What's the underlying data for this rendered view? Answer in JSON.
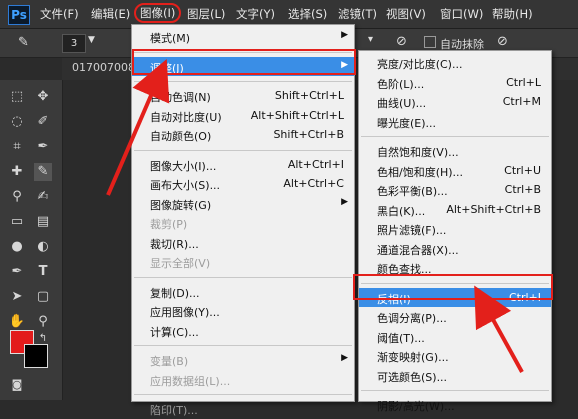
{
  "app": {
    "logo": "Ps"
  },
  "menubar": {
    "items": [
      "文件(F)",
      "编辑(E)",
      "图像(I)",
      "图层(L)",
      "文字(Y)",
      "选择(S)",
      "滤镜(T)",
      "视图(V)",
      "窗口(W)",
      "帮助(H)"
    ]
  },
  "options": {
    "brush_size": "3",
    "auto_erase": "自动抹除"
  },
  "document": {
    "tab": "017007008"
  },
  "image_menu": [
    {
      "label": "模式(M)",
      "shortcut": "",
      "submenu": true,
      "disabled": false
    },
    {
      "sep": true
    },
    {
      "label": "调整(J)",
      "shortcut": "",
      "submenu": true,
      "disabled": false,
      "highlight": true
    },
    {
      "sep": true
    },
    {
      "label": "自动色调(N)",
      "shortcut": "Shift+Ctrl+L",
      "disabled": false
    },
    {
      "label": "自动对比度(U)",
      "shortcut": "Alt+Shift+Ctrl+L",
      "disabled": false
    },
    {
      "label": "自动颜色(O)",
      "shortcut": "Shift+Ctrl+B",
      "disabled": false
    },
    {
      "sep": true
    },
    {
      "label": "图像大小(I)...",
      "shortcut": "Alt+Ctrl+I",
      "disabled": false
    },
    {
      "label": "画布大小(S)...",
      "shortcut": "Alt+Ctrl+C",
      "disabled": false
    },
    {
      "label": "图像旋转(G)",
      "shortcut": "",
      "submenu": true,
      "disabled": false
    },
    {
      "label": "裁剪(P)",
      "shortcut": "",
      "disabled": true
    },
    {
      "label": "裁切(R)...",
      "shortcut": "",
      "disabled": false
    },
    {
      "label": "显示全部(V)",
      "shortcut": "",
      "disabled": true
    },
    {
      "sep": true
    },
    {
      "label": "复制(D)...",
      "shortcut": "",
      "disabled": false
    },
    {
      "label": "应用图像(Y)...",
      "shortcut": "",
      "disabled": false
    },
    {
      "label": "计算(C)...",
      "shortcut": "",
      "disabled": false
    },
    {
      "sep": true
    },
    {
      "label": "变量(B)",
      "shortcut": "",
      "submenu": true,
      "disabled": true
    },
    {
      "label": "应用数据组(L)...",
      "shortcut": "",
      "disabled": true
    },
    {
      "sep": true
    },
    {
      "label": "陷印(T)...",
      "shortcut": "",
      "disabled": true
    }
  ],
  "adjust_menu": [
    {
      "label": "亮度/对比度(C)...",
      "shortcut": ""
    },
    {
      "label": "色阶(L)...",
      "shortcut": "Ctrl+L"
    },
    {
      "label": "曲线(U)...",
      "shortcut": "Ctrl+M"
    },
    {
      "label": "曝光度(E)...",
      "shortcut": ""
    },
    {
      "sep": true
    },
    {
      "label": "自然饱和度(V)...",
      "shortcut": ""
    },
    {
      "label": "色相/饱和度(H)...",
      "shortcut": "Ctrl+U"
    },
    {
      "label": "色彩平衡(B)...",
      "shortcut": "Ctrl+B"
    },
    {
      "label": "黑白(K)...",
      "shortcut": "Alt+Shift+Ctrl+B"
    },
    {
      "label": "照片滤镜(F)...",
      "shortcut": ""
    },
    {
      "label": "通道混合器(X)...",
      "shortcut": ""
    },
    {
      "label": "颜色查找...",
      "shortcut": ""
    },
    {
      "sep": true
    },
    {
      "label": "反相(I)",
      "shortcut": "Ctrl+I",
      "highlight": true
    },
    {
      "label": "色调分离(P)...",
      "shortcut": ""
    },
    {
      "label": "阈值(T)...",
      "shortcut": ""
    },
    {
      "label": "渐变映射(G)...",
      "shortcut": ""
    },
    {
      "label": "可选颜色(S)...",
      "shortcut": ""
    },
    {
      "sep": true
    },
    {
      "label": "阴影/高光(W)...",
      "shortcut": ""
    }
  ],
  "colors": {
    "highlight": "#3a8ee6",
    "annotation": "#e3201b",
    "foreground": "#e31b1b",
    "background": "#000000"
  }
}
